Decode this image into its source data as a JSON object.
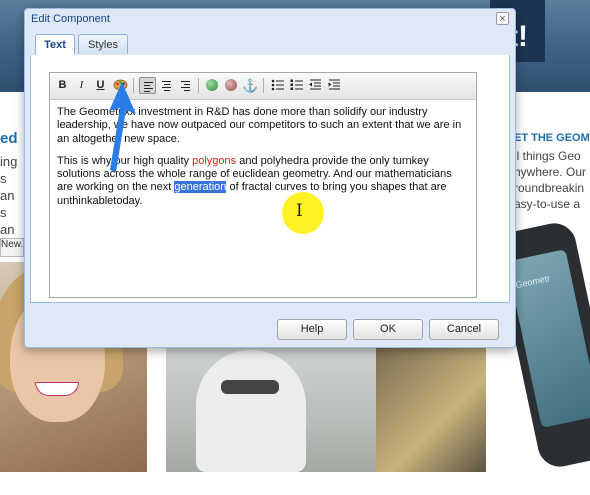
{
  "background": {
    "banner_text": "t!",
    "left_heading": "ed",
    "left_lines": [
      "ing",
      "s an",
      "s an"
    ],
    "left_button": "New...",
    "right_heading": "ET THE GEOM",
    "right_lines": [
      "ll things Geo",
      "nywhere. Our",
      "roundbreakin",
      "asy-to-use a"
    ],
    "phone_text": "Geometr"
  },
  "dialog": {
    "title": "Edit Component",
    "close_glyph": "×",
    "tabs": [
      {
        "label": "Text",
        "selected": true
      },
      {
        "label": "Styles",
        "selected": false
      }
    ],
    "toolbar": {
      "bold": "B",
      "italic": "I",
      "underline": "U",
      "anchor_glyph": "⚓"
    },
    "content": {
      "p1": "The Geometrixx investment in R&D has done more than solidify our industry leadership, we have now outpaced our competitors to such an extent that we are in an altogether new space.",
      "p2_before": "This is why our high quality ",
      "p2_link": "polygons",
      "p2_middle": " and polyhedra provide the only turnkey solutions across the whole range of euclidean geometry. And our mathematicians are working on the next ",
      "p2_selected": "generation",
      "p2_after": " of fractal curves to bring you shapes that are unthinkabletoday."
    },
    "buttons": {
      "help": "Help",
      "ok": "OK",
      "cancel": "Cancel"
    }
  },
  "overlays": {
    "ibeam_glyph": "I",
    "highlight_color": "#ffee00",
    "arrow_color": "#2b7de9"
  }
}
